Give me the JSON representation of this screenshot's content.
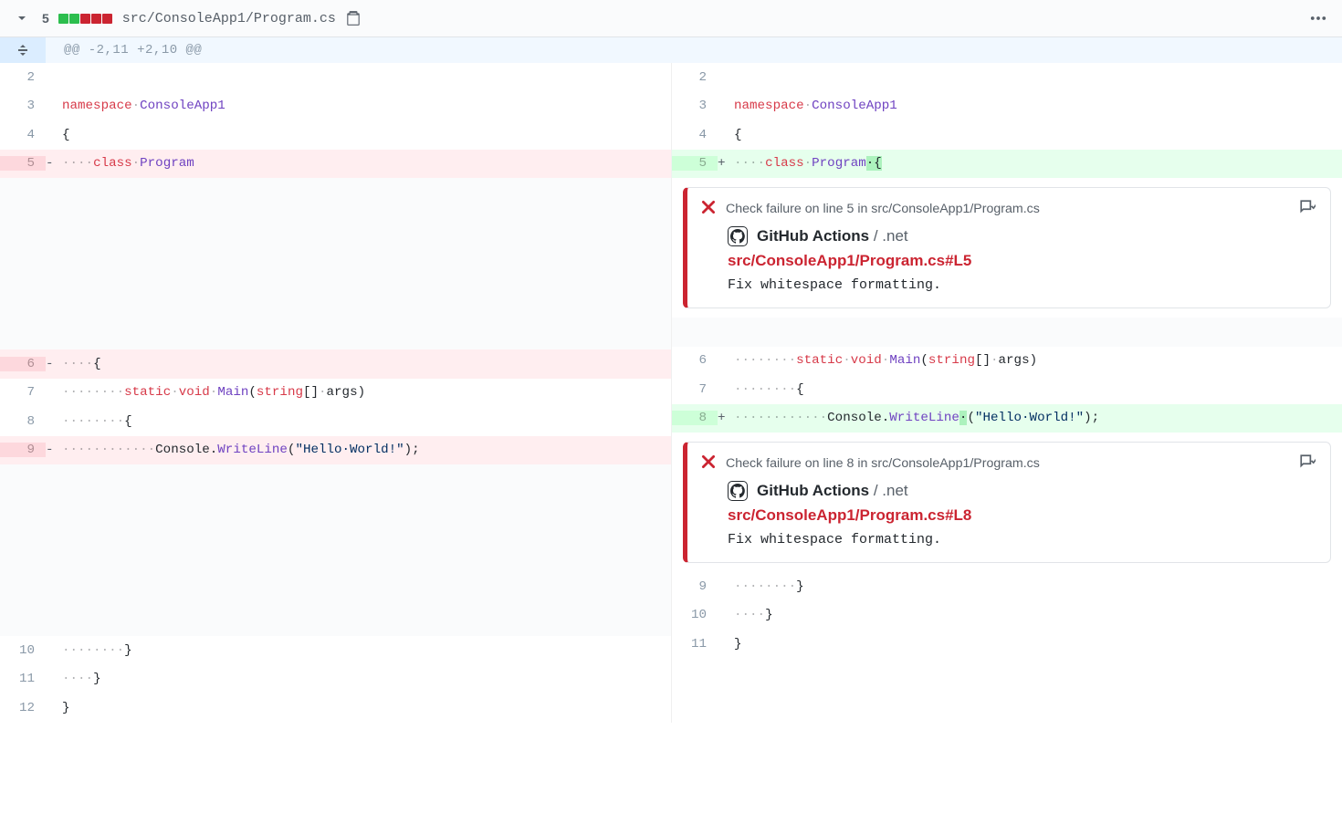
{
  "header": {
    "change_count": "5",
    "file_path": "src/ConsoleApp1/Program.cs",
    "bars": [
      "add",
      "add",
      "del",
      "del",
      "del"
    ]
  },
  "hunk": "@@ -2,11 +2,10 @@",
  "left": {
    "r2": {
      "ln": "2",
      "code": ""
    },
    "r3": {
      "ln": "3",
      "kw1": "namespace",
      "ws1": "·",
      "nm1": "ConsoleApp1"
    },
    "r4": {
      "ln": "4",
      "code": "{"
    },
    "r5": {
      "ln": "5",
      "marker": "-",
      "ws1": "····",
      "kw1": "class",
      "ws2": "·",
      "nm1": "Program"
    },
    "r6": {
      "ln": "6",
      "marker": "-",
      "ws1": "····",
      "code": "{"
    },
    "r7": {
      "ln": "7",
      "ws1": "········",
      "kw1": "static",
      "ws2": "·",
      "kw2": "void",
      "ws3": "·",
      "fn": "Main",
      "p1": "(",
      "kw3": "string",
      "p2": "[]",
      "ws4": "·",
      "arg": "args",
      "p3": ")"
    },
    "r8": {
      "ln": "8",
      "ws1": "········",
      "code": "{"
    },
    "r9": {
      "ln": "9",
      "marker": "-",
      "ws1": "············",
      "obj": "Console",
      "dot": ".",
      "fn": "WriteLine",
      "p1": "(",
      "str": "\"Hello·World!\"",
      "p2": ");"
    },
    "r10": {
      "ln": "10",
      "ws1": "········",
      "code": "}"
    },
    "r11": {
      "ln": "11",
      "ws1": "····",
      "code": "}"
    },
    "r12": {
      "ln": "12",
      "code": "}"
    }
  },
  "right": {
    "r2": {
      "ln": "2",
      "code": ""
    },
    "r3": {
      "ln": "3",
      "kw1": "namespace",
      "ws1": "·",
      "nm1": "ConsoleApp1"
    },
    "r4": {
      "ln": "4",
      "code": "{"
    },
    "r5": {
      "ln": "5",
      "marker": "+",
      "ws1": "····",
      "kw1": "class",
      "ws2": "·",
      "nm1": "Program",
      "hl": "·{"
    },
    "r6": {
      "ln": "6",
      "ws1": "········",
      "kw1": "static",
      "ws2": "·",
      "kw2": "void",
      "ws3": "·",
      "fn": "Main",
      "p1": "(",
      "kw3": "string",
      "p2": "[]",
      "ws4": "·",
      "arg": "args",
      "p3": ")"
    },
    "r7": {
      "ln": "7",
      "ws1": "········",
      "code": "{"
    },
    "r8": {
      "ln": "8",
      "marker": "+",
      "ws1": "············",
      "obj": "Console",
      "dot": ".",
      "fn": "WriteLine",
      "hl": "·",
      "p1": "(",
      "str": "\"Hello·World!\"",
      "p2": ");"
    },
    "r9": {
      "ln": "9",
      "ws1": "········",
      "code": "}"
    },
    "r10": {
      "ln": "10",
      "ws1": "····",
      "code": "}"
    },
    "r11": {
      "ln": "11",
      "code": "}"
    }
  },
  "ann1": {
    "head": "Check failure on line 5 in src/ConsoleApp1/Program.cs",
    "source": "GitHub Actions",
    "context": " / .net",
    "link": "src/ConsoleApp1/Program.cs#L5",
    "message": "Fix whitespace formatting."
  },
  "ann2": {
    "head": "Check failure on line 8 in src/ConsoleApp1/Program.cs",
    "source": "GitHub Actions",
    "context": " / .net",
    "link": "src/ConsoleApp1/Program.cs#L8",
    "message": "Fix whitespace formatting."
  }
}
